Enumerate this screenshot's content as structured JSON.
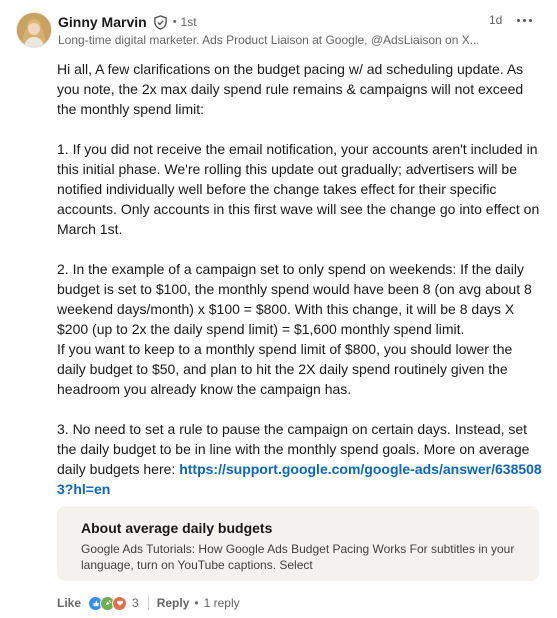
{
  "comment": {
    "author": {
      "name": "Ginny Marvin",
      "degree_separator": "•",
      "degree": "1st",
      "headline": "Long-time digital marketer. Ads Product Liaison at Google, @AdsLiaison on X..."
    },
    "timestamp": "1d",
    "body": {
      "intro": "Hi all, A few clarifications on the budget pacing w/ ad scheduling update. As you note, the 2x max daily spend rule remains & campaigns will not exceed the monthly spend limit:",
      "point1": "1. If you did not receive the email notification, your accounts aren't included in this initial phase. We're rolling this update out gradually; advertisers will be notified individually well before the change takes effect for their specific accounts. Only accounts in this first wave will see the change go into effect on March 1st.",
      "point2a": "2. In the example of a campaign set to only spend on weekends: If the daily budget is set to $100, the monthly spend would have been 8 (on avg about 8 weekend days/month) x $100 = $800. With this change, it will be 8 days X $200 (up to 2x the daily spend limit) = $1,600 monthly spend limit.",
      "point2b": "If you want to keep to a monthly spend limit of $800, you should lower the daily budget to $50, and plan to hit the 2X daily spend routinely given the headroom you already know the campaign has.",
      "point3": "3. No need to set a rule to pause the campaign on certain days. Instead, set the daily budget to be in line with the monthly spend goals. More on average daily budgets here: ",
      "link": "https://support.google.com/google-ads/answer/6385083?hl=en"
    },
    "link_preview": {
      "title": "About average daily budgets",
      "description": "Google Ads Tutorials: How Google Ads Budget Pacing Works For subtitles in your language, turn on YouTube captions. Select"
    },
    "actions": {
      "like_label": "Like",
      "reaction_icons": [
        "like-icon",
        "celebrate-icon",
        "love-icon"
      ],
      "reaction_count": "3",
      "reply_label": "Reply",
      "reply_separator": "•",
      "reply_count": "1 reply"
    },
    "colors": {
      "link": "#0a66c2",
      "like": "#378fe9",
      "celebrate": "#44712e",
      "love": "#df704d"
    }
  }
}
